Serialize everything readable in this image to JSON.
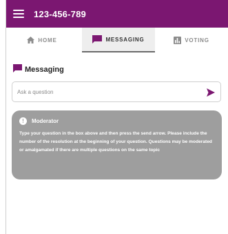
{
  "header": {
    "title": "123-456-789"
  },
  "tabs": [
    {
      "label": "HOME",
      "icon": "home-icon"
    },
    {
      "label": "MESSAGING",
      "icon": "message-icon",
      "active": true
    },
    {
      "label": "VOTING",
      "icon": "poll-icon"
    }
  ],
  "messaging": {
    "heading": "Messaging",
    "input_placeholder": "Ask a question",
    "notice": {
      "author": "Moderator",
      "text": "Type your question in the box above and then press the send arrow. Please include the number of the resolution at the beginning of your question. Questions may be moderated or amalgamated if there are multiple questions on the same topic"
    }
  },
  "colors": {
    "brand": "#7b1771",
    "notice_bg": "#9e9e9e",
    "tab_active_bg": "#eeeeee"
  }
}
